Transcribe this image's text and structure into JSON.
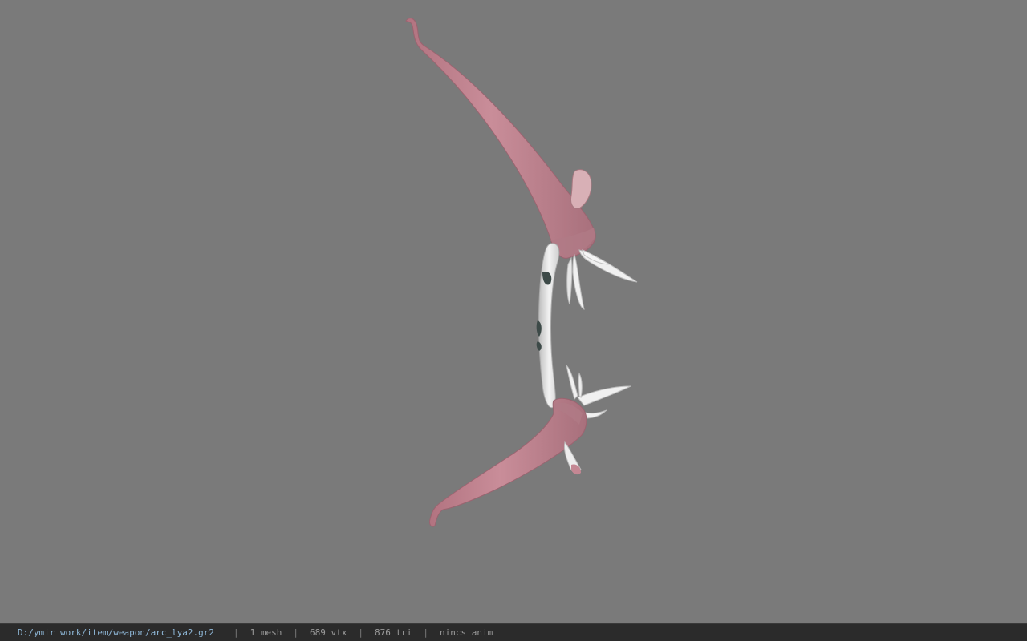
{
  "viewer": {
    "background_color": "#7a7a7a",
    "model_name": "bow-model",
    "model_colors": {
      "limb": "#c48793",
      "limb_shadow": "#a06a76",
      "grip": "#e6e6e6",
      "prong": "#f0f0f0",
      "mark": "#3d4a48"
    }
  },
  "status": {
    "path": "D:/ymir work/item/weapon/arc_lya2.gr2",
    "sep": "|",
    "mesh": "1 mesh",
    "vtx": "689 vtx",
    "tri": "876 tri",
    "anim": "nincs anim"
  }
}
